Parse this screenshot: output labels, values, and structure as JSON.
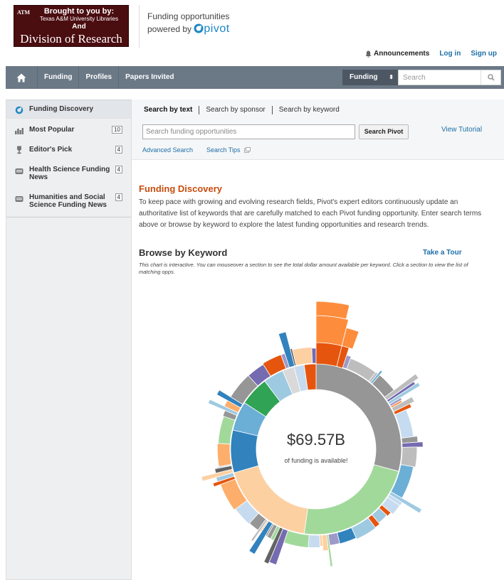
{
  "header": {
    "logo": {
      "line1": "Brought to you by:",
      "line2": "Texas A&M University Libraries",
      "line3": "And",
      "line4": "Division of Research",
      "mark": "ATM"
    },
    "powered_line1": "Funding opportunities",
    "powered_line2": "powered by",
    "brand": "pivot",
    "announcements": "Announcements",
    "login": "Log in",
    "signup": "Sign up"
  },
  "navbar": {
    "home_icon": "home-icon",
    "items": [
      "Funding",
      "Profiles",
      "Papers Invited"
    ],
    "select_value": "Funding",
    "search_placeholder": "Search"
  },
  "sidebar": {
    "items": [
      {
        "label": "Funding Discovery",
        "icon": "pivot-icon"
      },
      {
        "label": "Most Popular",
        "icon": "bar-chart-icon",
        "count": "10"
      },
      {
        "label": "Editor's Pick",
        "icon": "trophy-icon",
        "count": "4"
      },
      {
        "label": "Health Science Funding News",
        "icon": "newspaper-icon",
        "count": "4"
      },
      {
        "label": "Humanities and Social Science Funding News",
        "icon": "newspaper-icon",
        "count": "4"
      }
    ]
  },
  "search": {
    "tabs": [
      "Search by text",
      "Search by sponsor",
      "Search by keyword"
    ],
    "placeholder": "Search funding opportunities",
    "button": "Search Pivot",
    "view_tutorial": "View Tutorial",
    "advanced": "Advanced Search",
    "tips": "Search Tips"
  },
  "main": {
    "title": "Funding Discovery",
    "description": "To keep pace with growing and evolving research fields, Pivot's expert editors continuously update an authoritative list of keywords that are carefully matched to each Pivot funding opportunity. Enter search terms above or browse by keyword to explore the latest funding opportunities and research trends.",
    "browse_title": "Browse by Keyword",
    "take_tour": "Take a Tour",
    "note": "This chart is interactive. You can mouseover a section to see the total dollar amount available per keyword. Click a section to view the list of matching opps.",
    "total": "$69.57B",
    "total_caption": "of funding is available!"
  },
  "colors": {
    "accent": "#c64d0f",
    "link": "#1d6fa8",
    "navbar": "#6b7886",
    "pivot": "#1d86c8"
  }
}
